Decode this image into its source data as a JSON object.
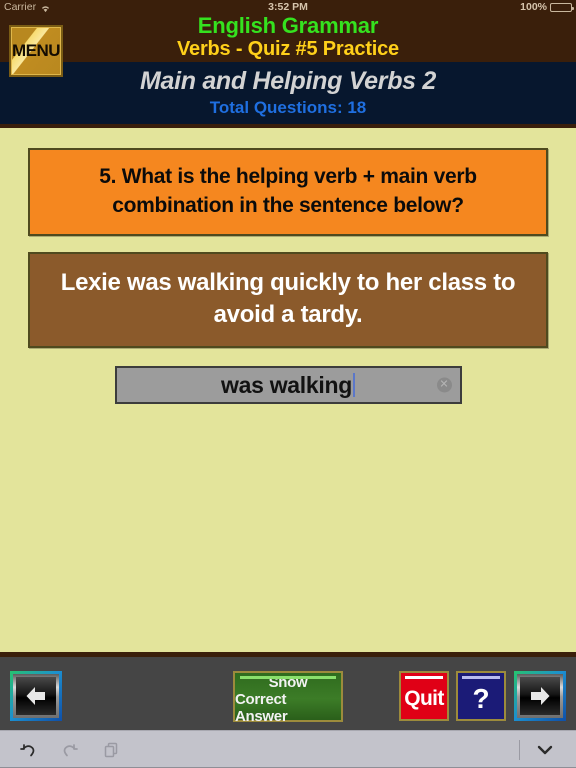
{
  "statusbar": {
    "carrier": "Carrier",
    "time": "3:52 PM",
    "battery_percent": "100%",
    "wifi_icon": "wifi-icon",
    "battery_icon": "battery-icon"
  },
  "header": {
    "menu_label": "MENU",
    "app_title": "English Grammar",
    "quiz_title": "Verbs - Quiz #5 Practice",
    "lesson_title": "Main and Helping Verbs 2",
    "total_questions_label": "Total Questions: 18",
    "app_title_color": "#35E21F",
    "quiz_title_color": "#FFD01A",
    "lesson_title_color": "#D3D3D3",
    "total_questions_color": "#1F6FE0",
    "brown_bg": "#3A1F0B",
    "navy_bg": "#07172E"
  },
  "main": {
    "body_bg": "#E3E49B",
    "question": {
      "number": "5.",
      "text": "5. What is the helping verb + main verb combination in the sentence below?",
      "bg": "#F5871F"
    },
    "sentence": {
      "text": "Lexie was walking quickly to her class to avoid a tardy.",
      "bg": "#8B5A2B"
    },
    "answer_input": {
      "value": "was walking",
      "placeholder": "",
      "clear_icon": "clear-circle-icon",
      "bg": "#9C9C9C"
    }
  },
  "toolbar": {
    "back_label": "back-arrow",
    "forward_label": "forward-arrow",
    "show_answer_line1": "Show",
    "show_answer_line2": "Correct Answer",
    "quit_label": "Quit",
    "help_label": "?",
    "bg": "#454545",
    "show_answer_bg": "#3C7C27",
    "quit_bg": "#E00016",
    "help_bg": "#1B1B77"
  },
  "keyboard_bar": {
    "undo_icon": "undo-icon",
    "redo_icon": "redo-icon",
    "paste_icon": "paste-icon",
    "dismiss_icon": "chevron-down-icon",
    "bg": "#C3C3CB"
  }
}
